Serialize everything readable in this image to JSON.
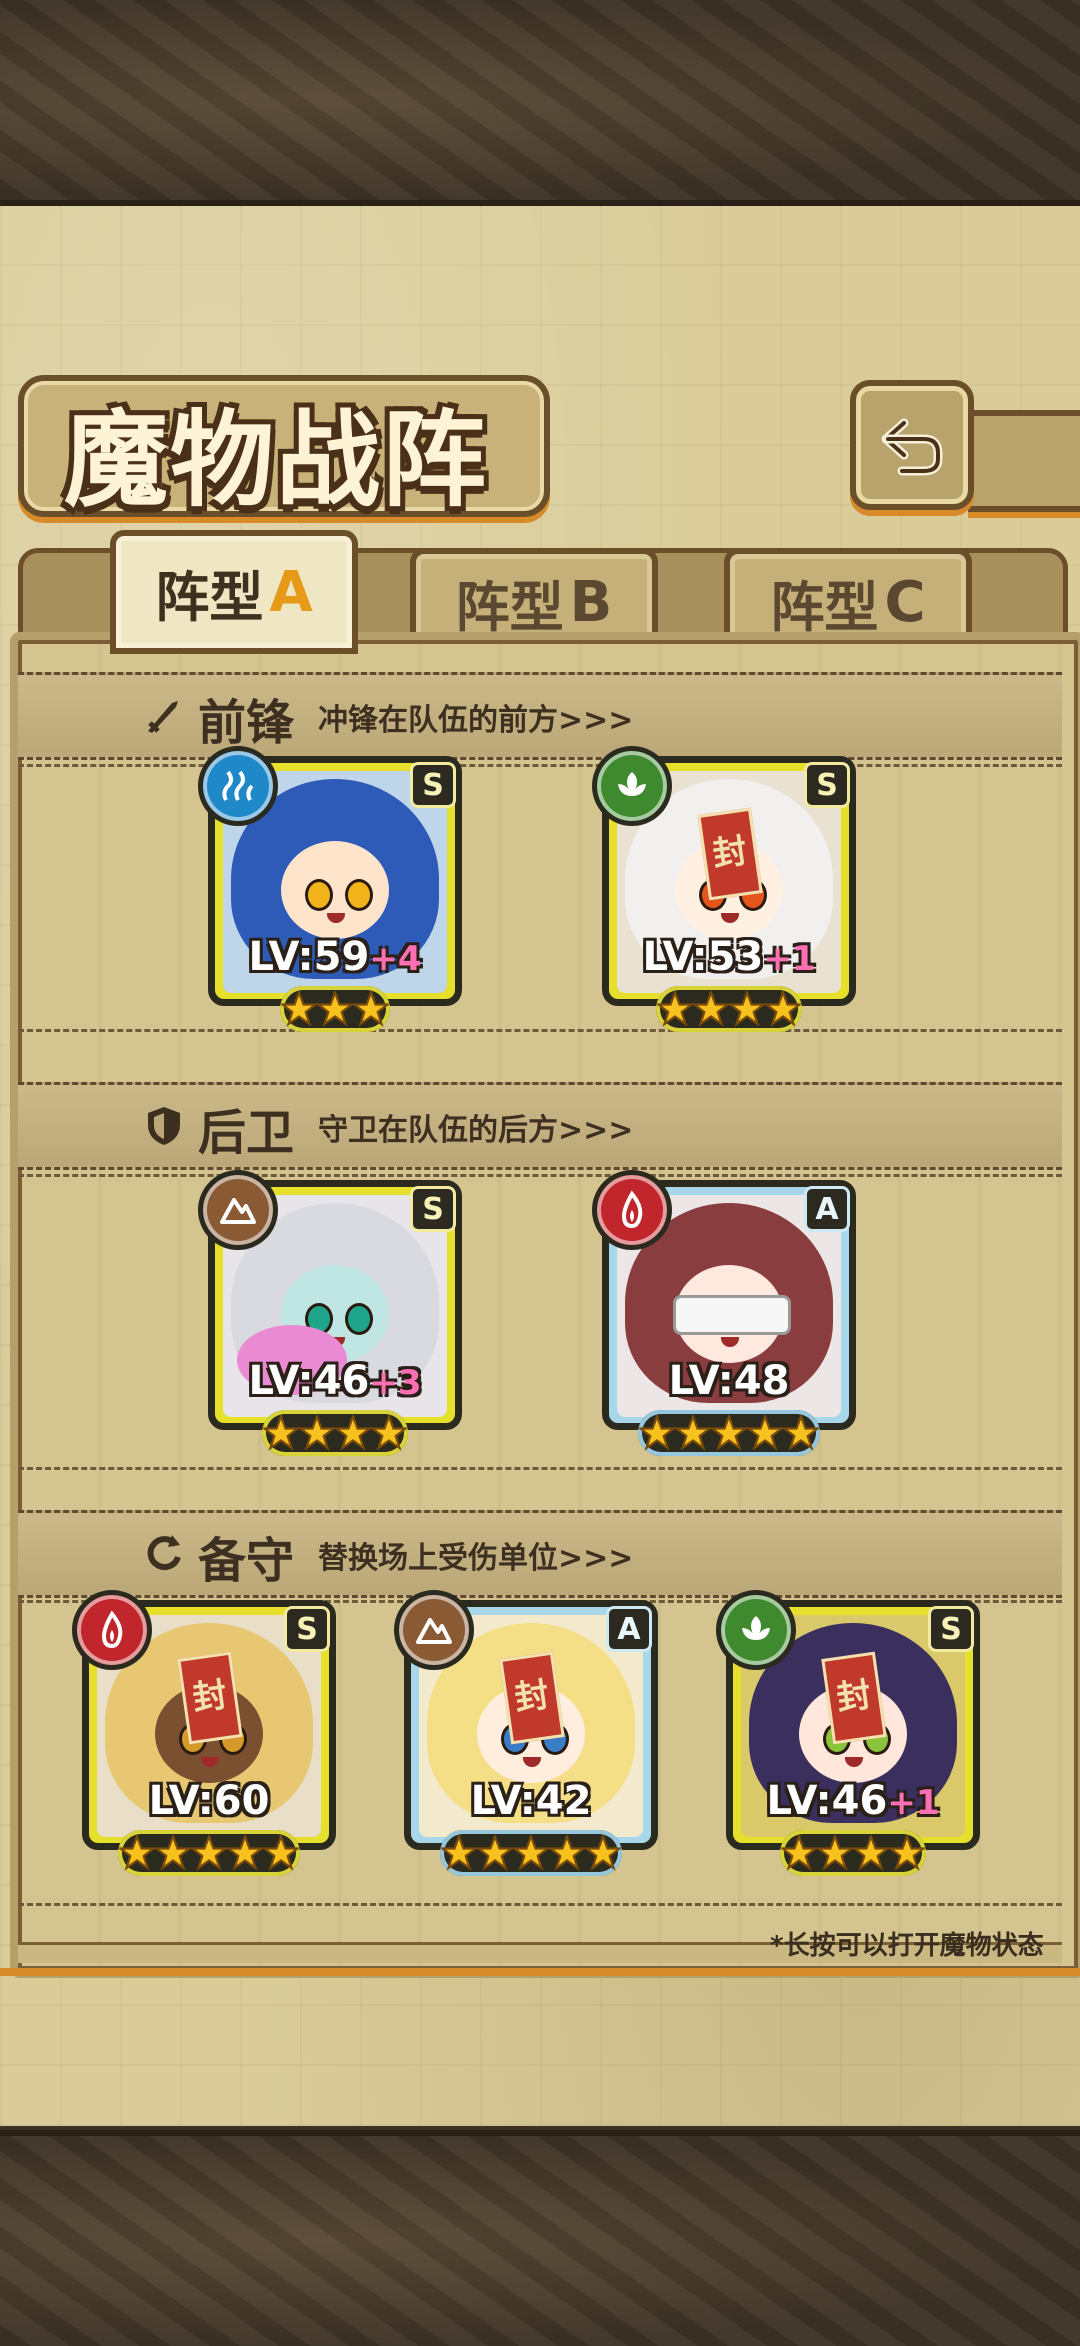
{
  "title": "魔物战阵",
  "tabs": [
    {
      "label": "阵型",
      "suffix": "A",
      "active": true
    },
    {
      "label": "阵型",
      "suffix": "B",
      "active": false
    },
    {
      "label": "阵型",
      "suffix": "C",
      "active": false
    }
  ],
  "sections": {
    "front": {
      "title": "前锋",
      "desc": "冲锋在队伍的前方>>>",
      "icon": "sword-icon"
    },
    "back": {
      "title": "后卫",
      "desc": "守卫在队伍的后方>>>",
      "icon": "shield-icon"
    },
    "reserve": {
      "title": "备守",
      "desc": "替换场上受伤单位>>>",
      "icon": "swap-icon"
    }
  },
  "front_cards": [
    {
      "rank": "S",
      "element": "water",
      "level": "LV:59",
      "bonus": "+4",
      "stars": 3
    },
    {
      "rank": "S",
      "element": "wind",
      "level": "LV:53",
      "bonus": "+1",
      "stars": 4
    }
  ],
  "back_cards": [
    {
      "rank": "S",
      "element": "earth",
      "level": "LV:46",
      "bonus": "+3",
      "stars": 4
    },
    {
      "rank": "A",
      "element": "fire",
      "level": "LV:48",
      "bonus": "",
      "stars": 5
    }
  ],
  "reserve_cards": [
    {
      "rank": "S",
      "element": "fire",
      "level": "LV:60",
      "bonus": "",
      "stars": 5
    },
    {
      "rank": "A",
      "element": "earth",
      "level": "LV:42",
      "bonus": "",
      "stars": 5
    },
    {
      "rank": "S",
      "element": "wind",
      "level": "LV:46",
      "bonus": "+1",
      "stars": 4
    }
  ],
  "hint": "*长按可以打开魔物状态",
  "colors": {
    "water": "#1e88c9",
    "wind": "#3f8a2e",
    "earth": "#8a5a35",
    "fire": "#c0262b",
    "star": "#f7c21e"
  }
}
